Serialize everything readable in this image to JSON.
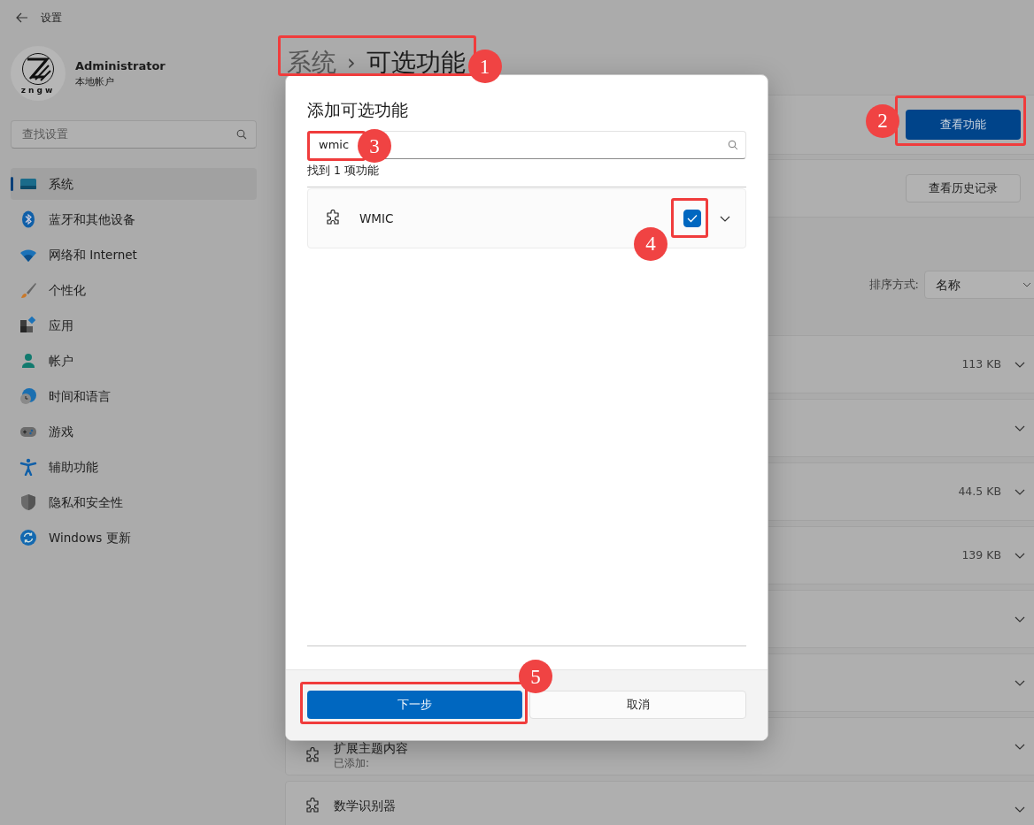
{
  "window": {
    "title": "设置"
  },
  "account": {
    "logo": "zngw",
    "name": "Administrator",
    "type": "本地帐户"
  },
  "search": {
    "placeholder": "查找设置"
  },
  "nav": [
    {
      "label": "系统",
      "selected": true
    },
    {
      "label": "蓝牙和其他设备",
      "selected": false
    },
    {
      "label": "网络和 Internet",
      "selected": false
    },
    {
      "label": "个性化",
      "selected": false
    },
    {
      "label": "应用",
      "selected": false
    },
    {
      "label": "帐户",
      "selected": false
    },
    {
      "label": "时间和语言",
      "selected": false
    },
    {
      "label": "游戏",
      "selected": false
    },
    {
      "label": "辅助功能",
      "selected": false
    },
    {
      "label": "隐私和安全性",
      "selected": false
    },
    {
      "label": "Windows 更新",
      "selected": false
    }
  ],
  "breadcrumb": {
    "parent": "系统",
    "separator": "›",
    "current": "可选功能"
  },
  "add_card": {
    "button": "查看功能"
  },
  "history_card": {
    "button": "查看历史记录"
  },
  "sort": {
    "label": "排序方式:",
    "value": "名称"
  },
  "features": [
    {
      "size": "113 KB",
      "expanded": false
    },
    {
      "expanded": false
    },
    {
      "size": "44.5 KB",
      "expanded": false
    },
    {
      "size": "139 KB",
      "expanded": false
    },
    {
      "expanded": false
    },
    {
      "expanded": false
    },
    {
      "title": "扩展主题内容",
      "status": "已添加:",
      "expanded": false
    },
    {
      "title": "数学识别器",
      "expanded": false
    }
  ],
  "dialog": {
    "title": "添加可选功能",
    "search_value": "wmic",
    "result_count": "找到 1 项功能",
    "results": [
      {
        "name": "WMIC",
        "checked": true,
        "expanded": false
      }
    ],
    "buttons": [
      {
        "label": "下一步",
        "kind": "primary"
      },
      {
        "label": "取消",
        "kind": "secondary"
      }
    ]
  },
  "annotations": [
    {
      "number": "1"
    },
    {
      "number": "2"
    },
    {
      "number": "3"
    },
    {
      "number": "4"
    },
    {
      "number": "5"
    }
  ]
}
